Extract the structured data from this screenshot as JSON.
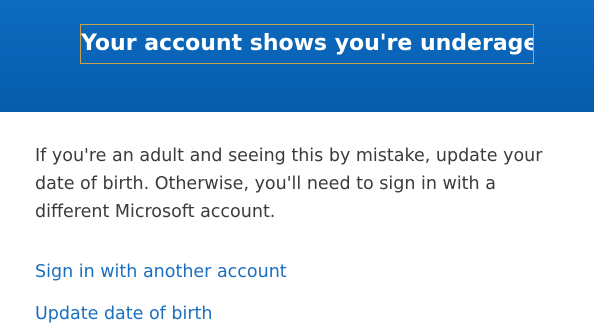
{
  "header": {
    "title": "Your account shows you're underage",
    "colors": {
      "background": "#0963b6",
      "title_border": "#c8a24a",
      "title_text": "#ffffff"
    }
  },
  "main": {
    "message": "If you're an adult and seeing this by mistake, update your date of birth. Otherwise, you'll need to sign in with a different Microsoft account.",
    "links": {
      "sign_in_other": "Sign in with another account",
      "update_dob": "Update date of birth"
    },
    "colors": {
      "text": "#3b3b3b",
      "link": "#1a6fc0"
    }
  }
}
